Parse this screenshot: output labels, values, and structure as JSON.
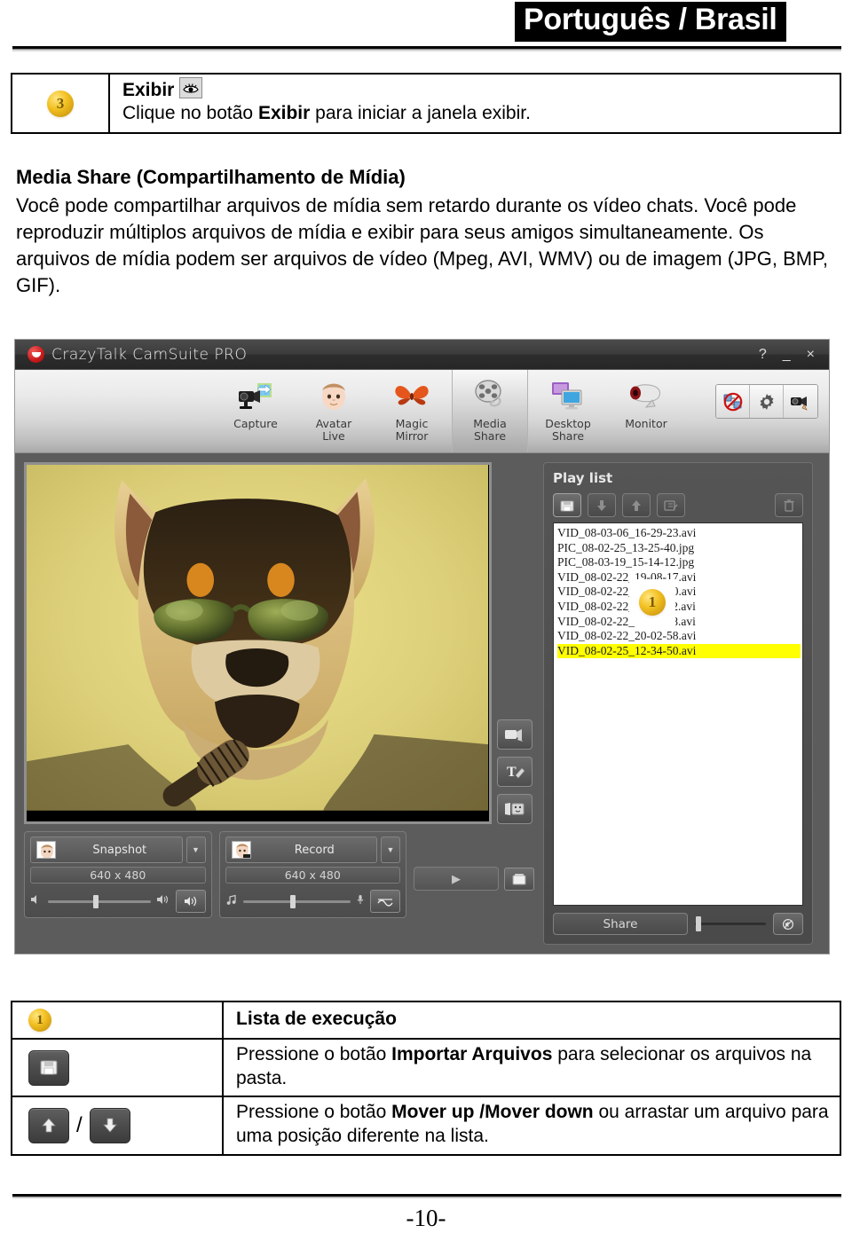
{
  "header": {
    "language_banner": "Português / Brasil"
  },
  "step": {
    "number": "3",
    "title": "Exibir",
    "title_icon": "eye-icon",
    "description_prefix": "Clique no botão ",
    "description_bold": "Exibir",
    "description_suffix": " para iniciar a janela exibir."
  },
  "section": {
    "heading": "Media Share (Compartilhamento de Mídia)",
    "body": "Você pode compartilhar arquivos de mídia sem retardo durante os vídeo chats. Você pode reproduzir múltiplos arquivos de mídia e exibir para seus amigos simultaneamente. Os arquivos de mídia podem ser arquivos de vídeo (Mpeg, AVI, WMV) ou de imagem (JPG, BMP, GIF)."
  },
  "app": {
    "title": "CrazyTalk CamSuite PRO",
    "window_controls": {
      "help": "?",
      "minimize": "_",
      "close": "×"
    },
    "toolbar": [
      {
        "label_line1": "Capture",
        "label_line2": "",
        "icon": "camcorder-export-icon",
        "active": false
      },
      {
        "label_line1": "Avatar",
        "label_line2": "Live",
        "icon": "baby-face-icon",
        "active": false
      },
      {
        "label_line1": "Magic",
        "label_line2": "Mirror",
        "icon": "butterfly-mask-icon",
        "active": false
      },
      {
        "label_line1": "Media",
        "label_line2": "Share",
        "icon": "film-reel-icon",
        "active": true
      },
      {
        "label_line1": "Desktop",
        "label_line2": "Share",
        "icon": "monitors-icon",
        "active": false
      },
      {
        "label_line1": "Monitor",
        "label_line2": "",
        "icon": "security-cam-icon",
        "active": false
      }
    ],
    "toolbar_right": [
      {
        "name": "no-video-icon"
      },
      {
        "name": "gear-icon"
      },
      {
        "name": "webcam-select-icon"
      }
    ],
    "video": {
      "side_buttons": [
        {
          "name": "webcam-source-icon"
        },
        {
          "name": "text-tool-icon"
        },
        {
          "name": "frame-emote-icon"
        }
      ],
      "snapshot": {
        "label": "Snapshot",
        "resolution": "640 x 480"
      },
      "record": {
        "label": "Record",
        "resolution": "640 x 480"
      }
    },
    "playlist": {
      "title": "Play list",
      "badge": "1",
      "buttons": [
        {
          "name": "import-files-icon",
          "enabled": true
        },
        {
          "name": "move-down-icon",
          "enabled": false
        },
        {
          "name": "move-up-icon",
          "enabled": false
        },
        {
          "name": "edit-properties-icon",
          "enabled": false
        },
        {
          "name": "delete-trash-icon",
          "enabled": false
        }
      ],
      "files": [
        {
          "name": "VID_08-03-06_16-29-23.avi",
          "selected": false
        },
        {
          "name": "PIC_08-02-25_13-25-40.jpg",
          "selected": false
        },
        {
          "name": "PIC_08-03-19_15-14-12.jpg",
          "selected": false
        },
        {
          "name": "VID_08-02-22_19-08-17.avi",
          "selected": false
        },
        {
          "name": "VID_08-02-22_19-09-10.avi",
          "selected": false
        },
        {
          "name": "VID_08-02-22_19-11-22.avi",
          "selected": false
        },
        {
          "name": "VID_08-02-22_19-11-58.avi",
          "selected": false
        },
        {
          "name": "VID_08-02-22_20-02-58.avi",
          "selected": false
        },
        {
          "name": "VID_08-02-25_12-34-50.avi",
          "selected": true
        }
      ],
      "share_label": "Share",
      "mute_icon": "mute-icon"
    }
  },
  "legend": {
    "rows": [
      {
        "icon_type": "badge",
        "badge": "1",
        "title": "Lista de execução",
        "text_parts": []
      },
      {
        "icon_type": "single-button",
        "icon": "import-files-icon",
        "title": "",
        "text_prefix": "Pressione o botão ",
        "text_bold": "Importar Arquivos",
        "text_suffix": " para selecionar os arquivos na pasta."
      },
      {
        "icon_type": "double-button",
        "icon_a": "move-up-icon",
        "icon_b": "move-down-icon",
        "separator": "/",
        "title": "",
        "text_prefix": "Pressione o botão ",
        "text_bold": "Mover up /Mover down",
        "text_suffix": " ou arrastar um arquivo para uma posição diferente na lista."
      }
    ]
  },
  "footer": {
    "page_number": "-10-"
  },
  "colors": {
    "banner_bg": "#000000",
    "badge_gold": "#f2c022",
    "selection_yellow": "#ffff00",
    "app_chrome": "#5c5c5c"
  }
}
